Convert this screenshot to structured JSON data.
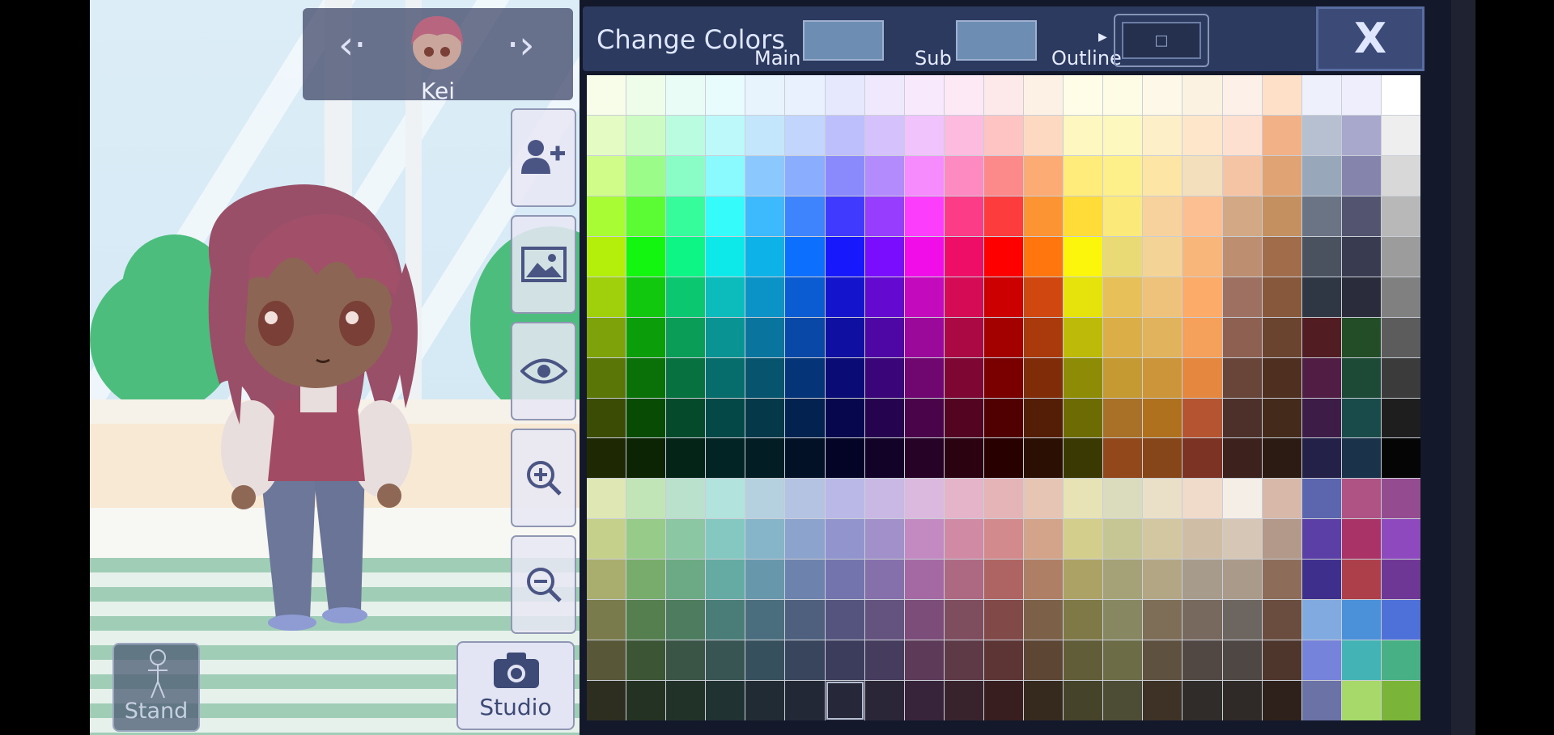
{
  "character": {
    "name": "Kei"
  },
  "left_buttons": {
    "stand_label": "Stand",
    "studio_label": "Studio"
  },
  "icons": [
    "chevron-left-icon",
    "chevron-right-icon",
    "add-person-icon",
    "image-icon",
    "eye-icon",
    "zoom-in-icon",
    "zoom-out-icon",
    "mannequin-icon",
    "camera-icon",
    "close-icon"
  ],
  "panel": {
    "title": "Change Colors",
    "main_label": "Main",
    "sub_label": "Sub",
    "outline_label": "Outline",
    "outline_symbol": "□",
    "close_label": "X",
    "main_color": "#6e8db2",
    "sub_color": "#6e8db2",
    "selected_cell": {
      "row": 15,
      "col": 6,
      "color": "#3c4356"
    }
  },
  "palette": [
    [
      "#f7fde9",
      "#eefcea",
      "#e9fcf5",
      "#e9fcfd",
      "#e8f4fd",
      "#e8f1fd",
      "#e6e8fd",
      "#f0e9fe",
      "#f8e9fd",
      "#fde9f5",
      "#fde9ea",
      "#fdf0e5",
      "#fffce8",
      "#fefce5",
      "#fdf8e8",
      "#fcf2e2",
      "#fdf0e8",
      "#fde0c7",
      "#eef1fc",
      "#efeefc",
      "#ffffff"
    ],
    [
      "#e4fcc4",
      "#ccfcc4",
      "#bafce0",
      "#bdf9fb",
      "#c3e6fd",
      "#c2d5fd",
      "#bdbffd",
      "#d5c2fd",
      "#f1c3fd",
      "#fdbcdf",
      "#fdc4c3",
      "#fdd9c2",
      "#fff6c0",
      "#fdf8bd",
      "#fdf0c8",
      "#fde6ca",
      "#fde0d0",
      "#f2b186",
      "#b6c0d1",
      "#a8a8cc",
      "#eeeeee"
    ],
    [
      "#d0fc8a",
      "#9cfc8a",
      "#8afcc6",
      "#8afaff",
      "#8ac8fd",
      "#8aaefd",
      "#8a8afd",
      "#b38bfd",
      "#f58bfd",
      "#fd8bc2",
      "#fd8a8a",
      "#fdab75",
      "#ffec7a",
      "#fdf08a",
      "#fde5a5",
      "#f4dfbd",
      "#f4c4a4",
      "#e0a373",
      "#99a7bb",
      "#8484ad",
      "#d8d8d8"
    ],
    [
      "#a8fc34",
      "#5cfc34",
      "#36fc9c",
      "#35fbfb",
      "#3dbafd",
      "#3d84fd",
      "#3f3afd",
      "#973dfd",
      "#fc3dfb",
      "#fd3c87",
      "#fd3d3d",
      "#fd9434",
      "#ffdc38",
      "#fbe97a",
      "#f8d29c",
      "#fcbf91",
      "#d3a885",
      "#c4905f",
      "#6a7484",
      "#525470",
      "#b8b8b8"
    ],
    [
      "#b4ef0b",
      "#13f60f",
      "#0df585",
      "#0de8e8",
      "#0db3e8",
      "#0d6ffd",
      "#1818fd",
      "#7a0dfd",
      "#f00de8",
      "#ee0e67",
      "#ff0000",
      "#ff750e",
      "#fcf60d",
      "#eada76",
      "#f4d396",
      "#f9b67a",
      "#bd8e70",
      "#a06c4a",
      "#4a5260",
      "#393b51",
      "#9c9c9c"
    ],
    [
      "#9fd00b",
      "#11c80e",
      "#0bc870",
      "#0cbcbc",
      "#0b93c8",
      "#0b5bd2",
      "#1414cc",
      "#6409cf",
      "#c30bbd",
      "#d60b55",
      "#cc0000",
      "#d04810",
      "#e6e20b",
      "#e8c05a",
      "#eec27b",
      "#fcab68",
      "#9e7062",
      "#87583b",
      "#2f3745",
      "#2a2c3c",
      "#808080"
    ],
    [
      "#7ea20a",
      "#0c9d0a",
      "#099d58",
      "#099393",
      "#09749d",
      "#0948a6",
      "#0f0fa2",
      "#4e07a4",
      "#9a099a",
      "#aa0944",
      "#a30000",
      "#aa3a0c",
      "#beba09",
      "#dbae48",
      "#e2b35d",
      "#f5a15c",
      "#8e6052",
      "#6b4430",
      "#521d22",
      "#224d27",
      "#5c5c5c"
    ],
    [
      "#5a7607",
      "#097108",
      "#077240",
      "#076c6c",
      "#07546f",
      "#063479",
      "#0b0b76",
      "#390579",
      "#700670",
      "#7d0632",
      "#7a0000",
      "#812c09",
      "#8e8c07",
      "#c69a33",
      "#cc9539",
      "#e6873f",
      "#694438",
      "#4f3020",
      "#521d45",
      "#1d4a37",
      "#3b3b3b"
    ],
    [
      "#3b4d05",
      "#074b05",
      "#054a2a",
      "#054848",
      "#053849",
      "#04224f",
      "#07074e",
      "#26034f",
      "#4a044a",
      "#530421",
      "#500000",
      "#541d06",
      "#6d6b03",
      "#a87127",
      "#b0711e",
      "#b45431",
      "#4e302a",
      "#432a1b",
      "#3d1d48",
      "#1a4b4b",
      "#1e1e1e"
    ],
    [
      "#1e2803",
      "#0c2403",
      "#032416",
      "#032424",
      "#031d24",
      "#031127",
      "#040426",
      "#130228",
      "#260226",
      "#2b0210",
      "#290000",
      "#2c0f03",
      "#3a3803",
      "#93481b",
      "#87461a",
      "#7d3323",
      "#3d211c",
      "#2b1b12",
      "#232148",
      "#1a334a",
      "#050505"
    ],
    [
      "#dfe7b4",
      "#c2e5b8",
      "#b9e1cb",
      "#b3e3dd",
      "#b5d1df",
      "#b4c3e2",
      "#b9b8e6",
      "#c9b8e4",
      "#dbb9de",
      "#e6b4c8",
      "#e5b4b7",
      "#e6c5b4",
      "#e7e3b7",
      "#dbdcbd",
      "#e9e0c7",
      "#f0dbcb",
      "#f4eee6",
      "#d7b8a9",
      "#5b66ae",
      "#ae5384",
      "#944b8f"
    ],
    [
      "#c5d18b",
      "#96cb89",
      "#8cc7a3",
      "#84c8c1",
      "#86b5ca",
      "#8ca3ce",
      "#9294cd",
      "#a190c9",
      "#c28ac1",
      "#d08aa4",
      "#d38a8c",
      "#d4a48a",
      "#d3ce8c",
      "#c6c594",
      "#d3c7a1",
      "#cfbda6",
      "#d6c6b5",
      "#b3998a",
      "#5b3ea6",
      "#a93266",
      "#8f49bf"
    ],
    [
      "#a9ae6e",
      "#77ac6c",
      "#6baa85",
      "#66aaa4",
      "#6797ab",
      "#6d82ad",
      "#7373ad",
      "#8570ab",
      "#a468a2",
      "#ad6882",
      "#ad6463",
      "#ae7f64",
      "#aca266",
      "#a6a277",
      "#b3a684",
      "#a79c8b",
      "#a99a8a",
      "#8d6c59",
      "#3f2f8d",
      "#ad3f4b",
      "#6e3796"
    ],
    [
      "#797b4c",
      "#567f4f",
      "#4e7c5f",
      "#4a7c78",
      "#4a6e7e",
      "#4f607f",
      "#55547e",
      "#63537e",
      "#7b4d78",
      "#7e4d5e",
      "#814a48",
      "#7d6048",
      "#7e7947",
      "#878761",
      "#7f6e57",
      "#77695e",
      "#6c6560",
      "#6a4d3e",
      "#80aae0",
      "#4b91d9",
      "#4e70d9"
    ],
    [
      "#585838",
      "#3c5535",
      "#3a5546",
      "#385553",
      "#36505d",
      "#38455c",
      "#3c3d5d",
      "#463c5d",
      "#5c3a58",
      "#5d3a46",
      "#5d3534",
      "#5e4634",
      "#615d38",
      "#6c6c47",
      "#5f513f",
      "#514844",
      "#4f4743",
      "#4e362c",
      "#7683da",
      "#43b3b5",
      "#47b185"
    ],
    [
      "#2d2d20",
      "#233223",
      "#213229",
      "#203231",
      "#212b33",
      "#222835",
      "#262739",
      "#2b2538",
      "#38243a",
      "#38222b",
      "#381e1e",
      "#362a1f",
      "#45442a",
      "#4d4d35",
      "#3e3125",
      "#302c29",
      "#2f2a28",
      "#2e201b",
      "#6b72a5",
      "#a6d96a",
      "#7ab53a"
    ]
  ]
}
